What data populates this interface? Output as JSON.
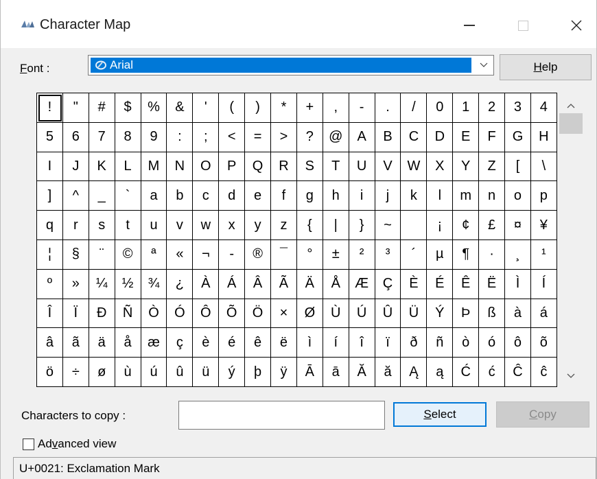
{
  "window": {
    "title": "Character Map"
  },
  "font_row": {
    "label_prefix": "F",
    "label_rest": "ont :",
    "selected_font": "Arial",
    "help_prefix": "H",
    "help_rest": "elp"
  },
  "characters": [
    "!",
    "\"",
    "#",
    "$",
    "%",
    "&",
    "'",
    "(",
    ")",
    "*",
    "+",
    ",",
    "-",
    ".",
    "/",
    "0",
    "1",
    "2",
    "3",
    "4",
    "5",
    "6",
    "7",
    "8",
    "9",
    ":",
    ";",
    "<",
    "=",
    ">",
    "?",
    "@",
    "A",
    "B",
    "C",
    "D",
    "E",
    "F",
    "G",
    "H",
    "I",
    "J",
    "K",
    "L",
    "M",
    "N",
    "O",
    "P",
    "Q",
    "R",
    "S",
    "T",
    "U",
    "V",
    "W",
    "X",
    "Y",
    "Z",
    "[",
    "\\",
    "]",
    "^",
    "_",
    "`",
    "a",
    "b",
    "c",
    "d",
    "e",
    "f",
    "g",
    "h",
    "i",
    "j",
    "k",
    "l",
    "m",
    "n",
    "o",
    "p",
    "q",
    "r",
    "s",
    "t",
    "u",
    "v",
    "w",
    "x",
    "y",
    "z",
    "{",
    "|",
    "}",
    "~",
    "",
    "¡",
    "¢",
    "£",
    "¤",
    "¥",
    "¦",
    "§",
    "¨",
    "©",
    "ª",
    "«",
    "¬",
    "-",
    "®",
    "¯",
    "°",
    "±",
    "²",
    "³",
    "´",
    "µ",
    "¶",
    "·",
    "¸",
    "¹",
    "º",
    "»",
    "¼",
    "½",
    "¾",
    "¿",
    "À",
    "Á",
    "Â",
    "Ã",
    "Ä",
    "Å",
    "Æ",
    "Ç",
    "È",
    "É",
    "Ê",
    "Ë",
    "Ì",
    "Í",
    "Î",
    "Ï",
    "Ð",
    "Ñ",
    "Ò",
    "Ó",
    "Ô",
    "Õ",
    "Ö",
    "×",
    "Ø",
    "Ù",
    "Ú",
    "Û",
    "Ü",
    "Ý",
    "Þ",
    "ß",
    "à",
    "á",
    "â",
    "ã",
    "ä",
    "å",
    "æ",
    "ç",
    "è",
    "é",
    "ê",
    "ë",
    "ì",
    "í",
    "î",
    "ï",
    "ð",
    "ñ",
    "ò",
    "ó",
    "ô",
    "õ",
    "ö",
    "÷",
    "ø",
    "ù",
    "ú",
    "û",
    "ü",
    "ý",
    "þ",
    "ÿ",
    "Ā",
    "ā",
    "Ă",
    "ă",
    "Ą",
    "ą",
    "Ć",
    "ć",
    "Ĉ",
    "ĉ"
  ],
  "selected_index": 0,
  "copy_row": {
    "label_prefix": "Characters to copy :",
    "value": "",
    "select_prefix": "S",
    "select_rest": "elect",
    "copy_prefix": "C",
    "copy_rest": "opy"
  },
  "advanced": {
    "label_a": "Ad",
    "label_u": "v",
    "label_b": "anced view",
    "checked": false
  },
  "status": {
    "text": "U+0021: Exclamation Mark"
  },
  "colors": {
    "selection": "#0078d7",
    "select_button_border": "#0078d7"
  },
  "icons": {
    "app": "character-map-icon",
    "font": "opentype-font-icon",
    "dropdown": "chevron-down-icon"
  }
}
